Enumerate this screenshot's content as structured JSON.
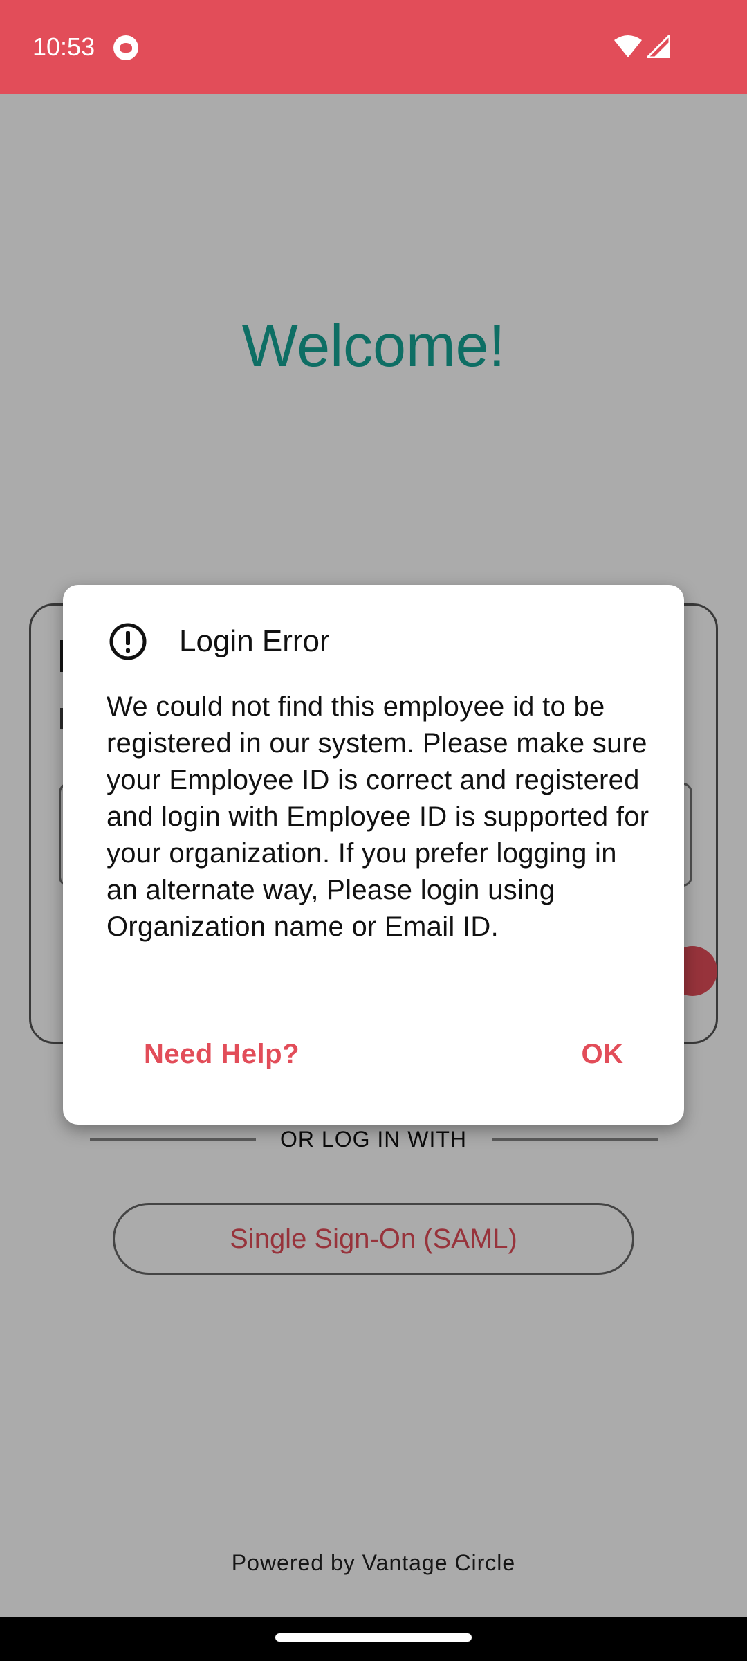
{
  "status_bar": {
    "time": "10:53",
    "app_icon": "app-notification-icon",
    "wifi_icon": "wifi-icon",
    "signal_icon": "signal-icon",
    "color": "#e24d59"
  },
  "page": {
    "welcome": "Welcome!",
    "or_login_with": "OR LOG IN WITH",
    "sso_button": "Single Sign-On (SAML)",
    "powered_by": "Powered by Vantage Circle",
    "accent_color": "#16a596",
    "brand_color": "#e24d59"
  },
  "dialog": {
    "icon": "alert-circle-icon",
    "title": "Login Error",
    "message": "We could not find this employee id to be registered in our system. Please make sure your Employee ID is correct and registered and login with Employee ID is supported for your organization. If you prefer logging in an alternate way, Please login using Organization name or Email ID.",
    "help_button": "Need Help?",
    "ok_button": "OK"
  }
}
